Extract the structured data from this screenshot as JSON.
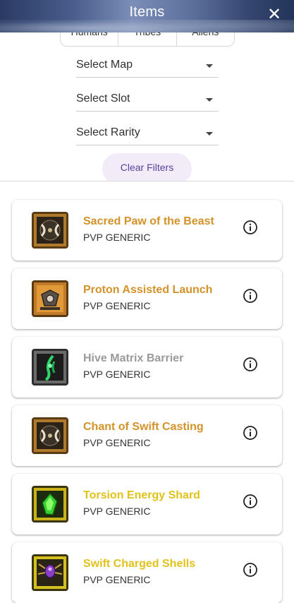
{
  "header": {
    "title": "Items",
    "close_label": "✕"
  },
  "filters": {
    "factions": [
      "Humans",
      "Tribes",
      "Aliens"
    ],
    "map_label": "Select Map",
    "slot_label": "Select Slot",
    "rarity_label": "Select Rarity",
    "clear_label": "Clear Filters"
  },
  "items": [
    {
      "name": "Sacred Paw of the Beast",
      "category": "PVP GENERIC",
      "name_color": "#d4922a",
      "icon": "paw-crest-icon"
    },
    {
      "name": "Proton Assisted Launch",
      "category": "PVP GENERIC",
      "name_color": "#d4922a",
      "icon": "cannon-icon"
    },
    {
      "name": "Hive Matrix Barrier",
      "category": "PVP GENERIC",
      "name_color": "#9a9a9a",
      "icon": "alien-claw-icon"
    },
    {
      "name": "Chant of Swift Casting",
      "category": "PVP GENERIC",
      "name_color": "#d4922a",
      "icon": "paw-crest-icon"
    },
    {
      "name": "Torsion Energy Shard",
      "category": "PVP GENERIC",
      "name_color": "#e0c21a",
      "icon": "green-shard-icon"
    },
    {
      "name": "Swift Charged Shells",
      "category": "PVP GENERIC",
      "name_color": "#e0c21a",
      "icon": "purple-spider-icon"
    }
  ]
}
